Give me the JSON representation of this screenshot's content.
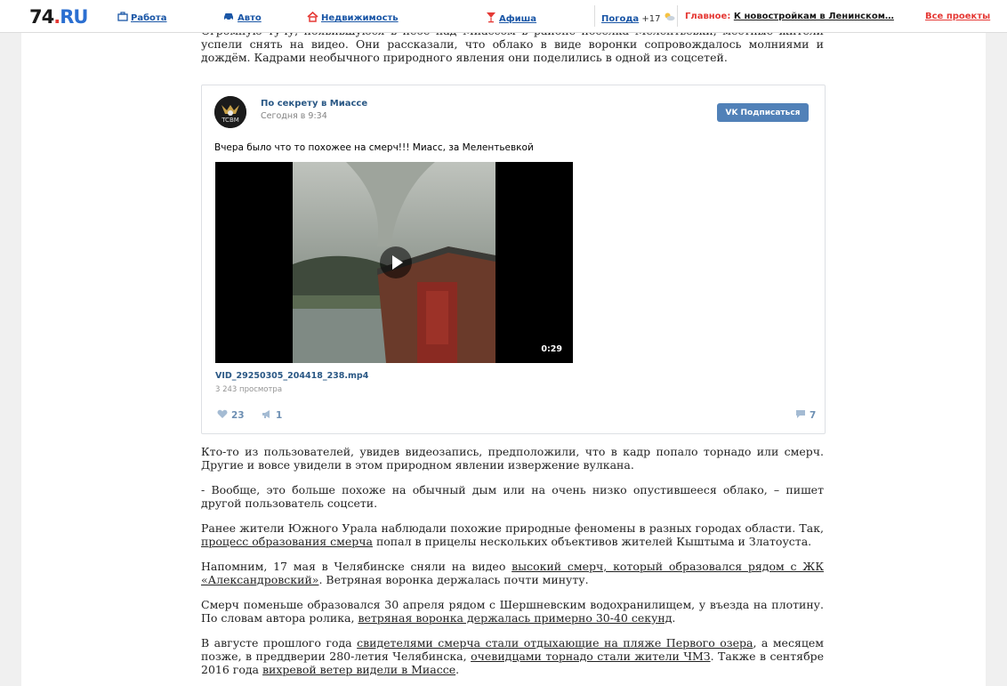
{
  "nav": {
    "logo_main": "74",
    "logo_dot": ".",
    "logo_ru": "RU",
    "items": [
      {
        "label": "Работа",
        "icon": "briefcase-icon",
        "glyph": "⌂"
      },
      {
        "label": "Авто",
        "icon": "car-icon",
        "glyph": "⛟"
      },
      {
        "label": "Недвижимость",
        "icon": "house-icon",
        "glyph": "⌂"
      },
      {
        "label": "Афиша",
        "icon": "cocktail-icon",
        "glyph": "Y"
      }
    ],
    "weather_label": "Погода",
    "weather_temp": "+17",
    "headline_label": "Главное:",
    "headline_text": "К новостройкам в Ленинском…",
    "all_projects": "Все проекты"
  },
  "article": {
    "p0": "Огромную тучу, появившуюся в небе над Миассом в районе поселка Мелентьевки, местные жители успели снять на видео. Они рассказали, что облако в виде воронки сопровождалось молниями и дождём. Кадрами необычного природного явления они поделились в одной из соцсетей.",
    "p1": "Кто-то из пользователей, увидев видеозапись, предположили, что в кадр попало торнадо или смерч. Другие и вовсе увидели в этом природном явлении извержение вулкана.",
    "p2": "- Вообще, это больше похоже на обычный дым или на очень низко опустившееся облако, – пишет другой пользователь соцсети.",
    "p3_a": "Ранее жители Южного Урала наблюдали похожие природные феномены в разных городах области. Так, ",
    "p3_link": "процесс образования смерча",
    "p3_b": " попал в прицелы нескольких объективов жителей Кыштыма и Златоуста.",
    "p4_a": "Напомним, 17 мая в Челябинске сняли на видео ",
    "p4_link": "высокий смерч, который образовался рядом с ЖК «Александровский»",
    "p4_b": ". Ветряная воронка держалась почти минуту.",
    "p5_a": "Смерч поменьше образовался 30 апреля рядом с Шершневским водохранилищем, у въезда на плотину. По словам автора ролика, ",
    "p5_link": "ветряная воронка держалась примерно 30-40 секунд",
    "p5_b": ".",
    "p6_a": "В августе прошлого года ",
    "p6_link1": "свидетелями смерча стали отдыхающие на пляже Первого озера",
    "p6_b": ", а месяцем позже, в преддверии 280-летия Челябинска, ",
    "p6_link2": "очевидцами торнадо стали жители ЧМЗ",
    "p6_c": ". Также в сентябре 2016 года ",
    "p6_link3": "вихревой ветер видели в Миассе",
    "p6_d": "."
  },
  "embed": {
    "avatar_text": "TCBM",
    "group_name": "По секрету в Миассе",
    "time": "Сегодня в 9:34",
    "subscribe_vk": "VK",
    "subscribe_label": "Подписаться",
    "text": "Вчера было что то похожее на смерч!!! Миасс, за Мелентьевкой",
    "video_duration": "0:29",
    "video_title": "VID_29250305_204418_238.mp4",
    "video_views": "3 243 просмотра",
    "likes": "23",
    "reposts": "1",
    "comments": "7"
  },
  "colors": {
    "vk_blue": "#5181b8",
    "link_blue": "#2a5885",
    "nav_blue": "#1a56a6",
    "accent_red": "#e53935"
  }
}
